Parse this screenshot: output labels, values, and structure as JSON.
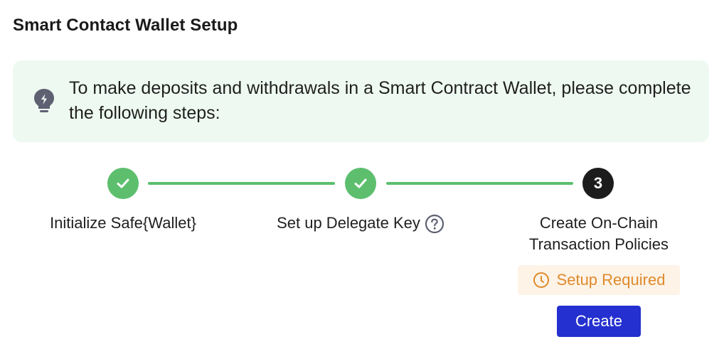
{
  "header": {
    "title": "Smart Contact Wallet Setup"
  },
  "info": {
    "icon": "lightbulb-icon",
    "text": "To make deposits and withdrawals in a Smart Contract Wallet, please complete the following steps:"
  },
  "steps": [
    {
      "label": "Initialize Safe{Wallet}",
      "status": "complete",
      "icon": "check-icon"
    },
    {
      "label": "Set up Delegate Key",
      "status": "complete",
      "icon": "check-icon",
      "help_icon": "question-circle-icon"
    },
    {
      "number": "3",
      "label_line1": "Create On-Chain",
      "label_line2": "Transaction Policies",
      "status": "current"
    }
  ],
  "status_badge": {
    "label": "Setup Required",
    "icon": "clock-icon",
    "color": "#e08a2c"
  },
  "actions": {
    "create_label": "Create"
  },
  "colors": {
    "success": "#5dbf6e",
    "primary": "#2430cf",
    "info_bg": "#eefaf1",
    "warning_bg": "#fdf3e7",
    "current_step": "#1c1c1c"
  }
}
